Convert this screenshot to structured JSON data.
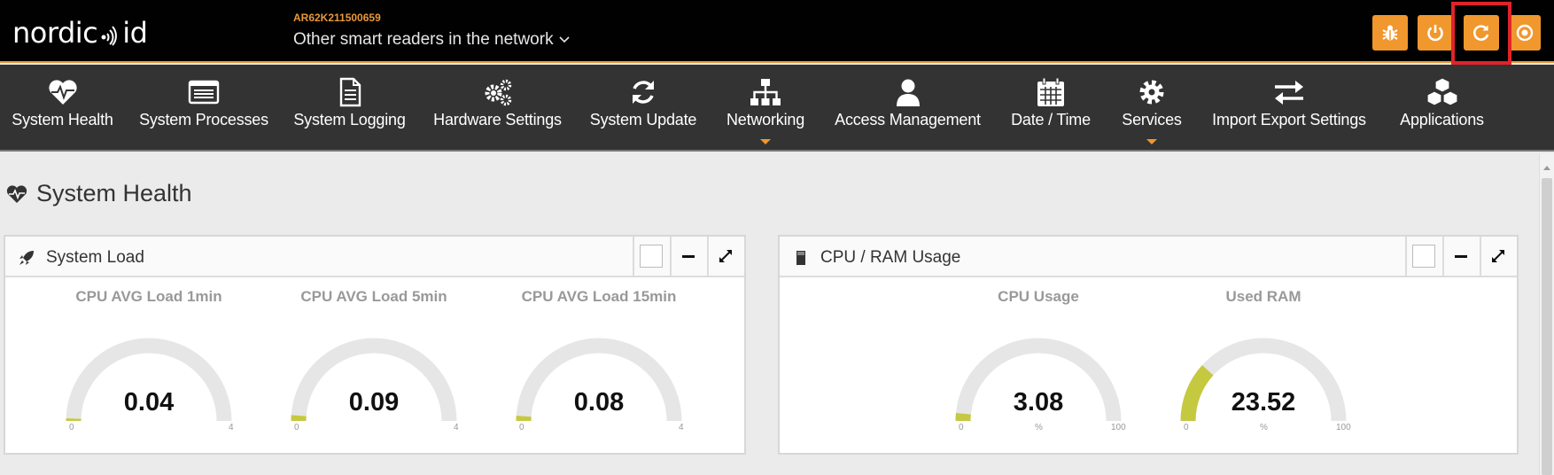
{
  "header": {
    "logo": {
      "part1": "nordic",
      "part2": "id"
    },
    "device_serial": "AR62K211500659",
    "network_menu": "Other smart readers in the network",
    "buttons": [
      {
        "name": "bug-button",
        "icon": "bug-icon"
      },
      {
        "name": "power-button",
        "icon": "power-icon"
      },
      {
        "name": "restart-button",
        "icon": "refresh-icon"
      },
      {
        "name": "target-button",
        "icon": "circle-dot-icon"
      }
    ],
    "accent_color": "#f0972e",
    "highlight_color": "#e0232a"
  },
  "nav": {
    "items": [
      {
        "label": "System Health",
        "icon": "heartbeat-icon"
      },
      {
        "label": "System Processes",
        "icon": "list-window-icon"
      },
      {
        "label": "System Logging",
        "icon": "document-icon"
      },
      {
        "label": "Hardware Settings",
        "icon": "gears-icon"
      },
      {
        "label": "System Update",
        "icon": "refresh-icon"
      },
      {
        "label": "Networking",
        "icon": "sitemap-icon",
        "dropdown": true
      },
      {
        "label": "Access Management",
        "icon": "user-icon"
      },
      {
        "label": "Date / Time",
        "icon": "calendar-icon"
      },
      {
        "label": "Services",
        "icon": "cog-icon",
        "dropdown": true
      },
      {
        "label": "Import Export Settings",
        "icon": "exchange-icon"
      },
      {
        "label": "Applications",
        "icon": "cubes-icon"
      }
    ]
  },
  "page": {
    "title": "System Health"
  },
  "panels": {
    "system_load": {
      "title": "System Load",
      "gauges": [
        {
          "label": "CPU AVG Load 1min",
          "value": "0.04",
          "min": "0",
          "max": "4",
          "unit": "",
          "fraction": 0.01
        },
        {
          "label": "CPU AVG Load 5min",
          "value": "0.09",
          "min": "0",
          "max": "4",
          "unit": "",
          "fraction": 0.0225
        },
        {
          "label": "CPU AVG Load 15min",
          "value": "0.08",
          "min": "0",
          "max": "4",
          "unit": "",
          "fraction": 0.02
        }
      ]
    },
    "cpu_ram": {
      "title": "CPU / RAM Usage",
      "gauges": [
        {
          "label": "CPU Usage",
          "value": "3.08",
          "min": "0",
          "max": "100",
          "unit": "%",
          "fraction": 0.0308
        },
        {
          "label": "Used RAM",
          "value": "23.52",
          "min": "0",
          "max": "100",
          "unit": "%",
          "fraction": 0.2352
        }
      ]
    }
  },
  "colors": {
    "gauge_fill": "#c5c940",
    "gauge_track": "#e6e6e6"
  }
}
